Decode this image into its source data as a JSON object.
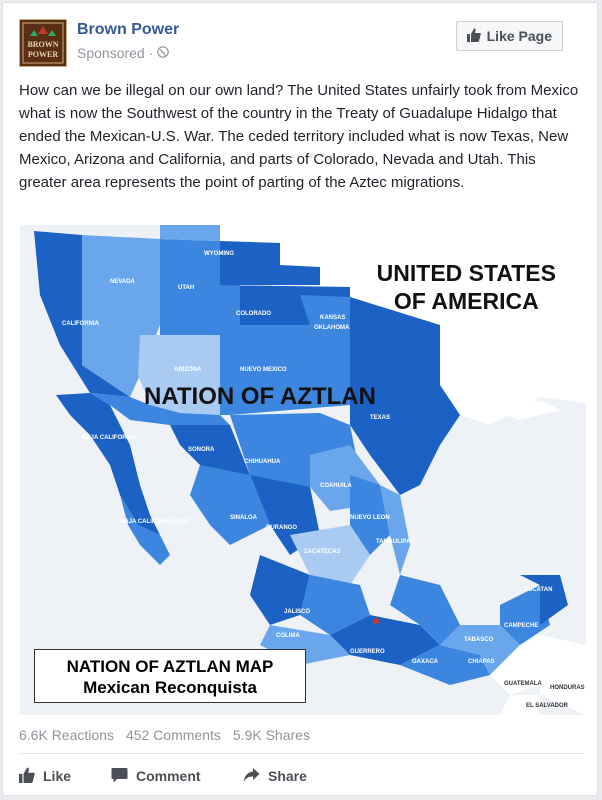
{
  "header": {
    "page_name": "Brown Power",
    "sponsored": "Sponsored",
    "dot": "·",
    "like_page_label": "Like Page",
    "avatar_text": [
      "BROWN",
      "POWER"
    ]
  },
  "post": {
    "text": "How can we be illegal on our own land? The United States unfairly took from Mexico what is now the Southwest of the country in the Treaty of Guadalupe Hidalgo that ended the Mexican-U.S. War. The ceded territory included what is now Texas, New Mexico, Arizona and California, and parts of Colorado, Nevada and Utah. This greater area represents the point of parting of the Aztec migrations."
  },
  "map": {
    "us_label_1": "UNITED STATES",
    "us_label_2": "OF AMERICA",
    "aztlan_label": "NATION OF AZTLAN",
    "title_line_1": "NATION OF AZTLAN MAP",
    "title_line_2": "Mexican Reconquista",
    "state_labels": {
      "wyoming": "WYOMING",
      "nevada": "NEVADA",
      "utah": "UTAH",
      "colorado": "COLORADO",
      "kansas": "KANSAS",
      "oklahoma": "OKLAHOMA",
      "california": "CALIFORNIA",
      "arizona": "ARIZONA",
      "nuevo_mexico": "NUEVO MEXICO",
      "texas": "TEXAS",
      "sonora": "SONORA",
      "chihuahua": "CHIHUAHUA",
      "coahuila": "COAHUILA",
      "baja_california": "BAJA CALIFORNIA",
      "baja_california_sur": "BAJA CALIFORNIA SUR",
      "sinaloa": "SINALOA",
      "durango": "DURANGO",
      "nuevo_leon": "NUEVO LEON",
      "tamaulipas": "TAMAULIPAS",
      "zacatecas": "ZACATECAS",
      "jalisco": "JALISCO",
      "colima": "COLIMA",
      "guerrero": "GUERRERO",
      "oaxaca": "OAXACA",
      "chiapas": "CHIAPAS",
      "tabasco": "TABASCO",
      "campeche": "CAMPECHE",
      "yucatan": "YUCATAN",
      "guatemala": "GUATEMALA",
      "honduras": "HONDURAS",
      "el_salvador": "EL SALVADOR"
    },
    "colors": {
      "water": "#eef2f6",
      "dark": "#1c62c4",
      "mid": "#3d86e0",
      "light": "#6aa6ec",
      "pale": "#a9cbf2",
      "us_land": "#ffffff"
    }
  },
  "stats": {
    "reactions": "6.6K Reactions",
    "comments": "452 Comments",
    "shares": "5.9K Shares"
  },
  "actions": {
    "like": "Like",
    "comment": "Comment",
    "share": "Share"
  }
}
